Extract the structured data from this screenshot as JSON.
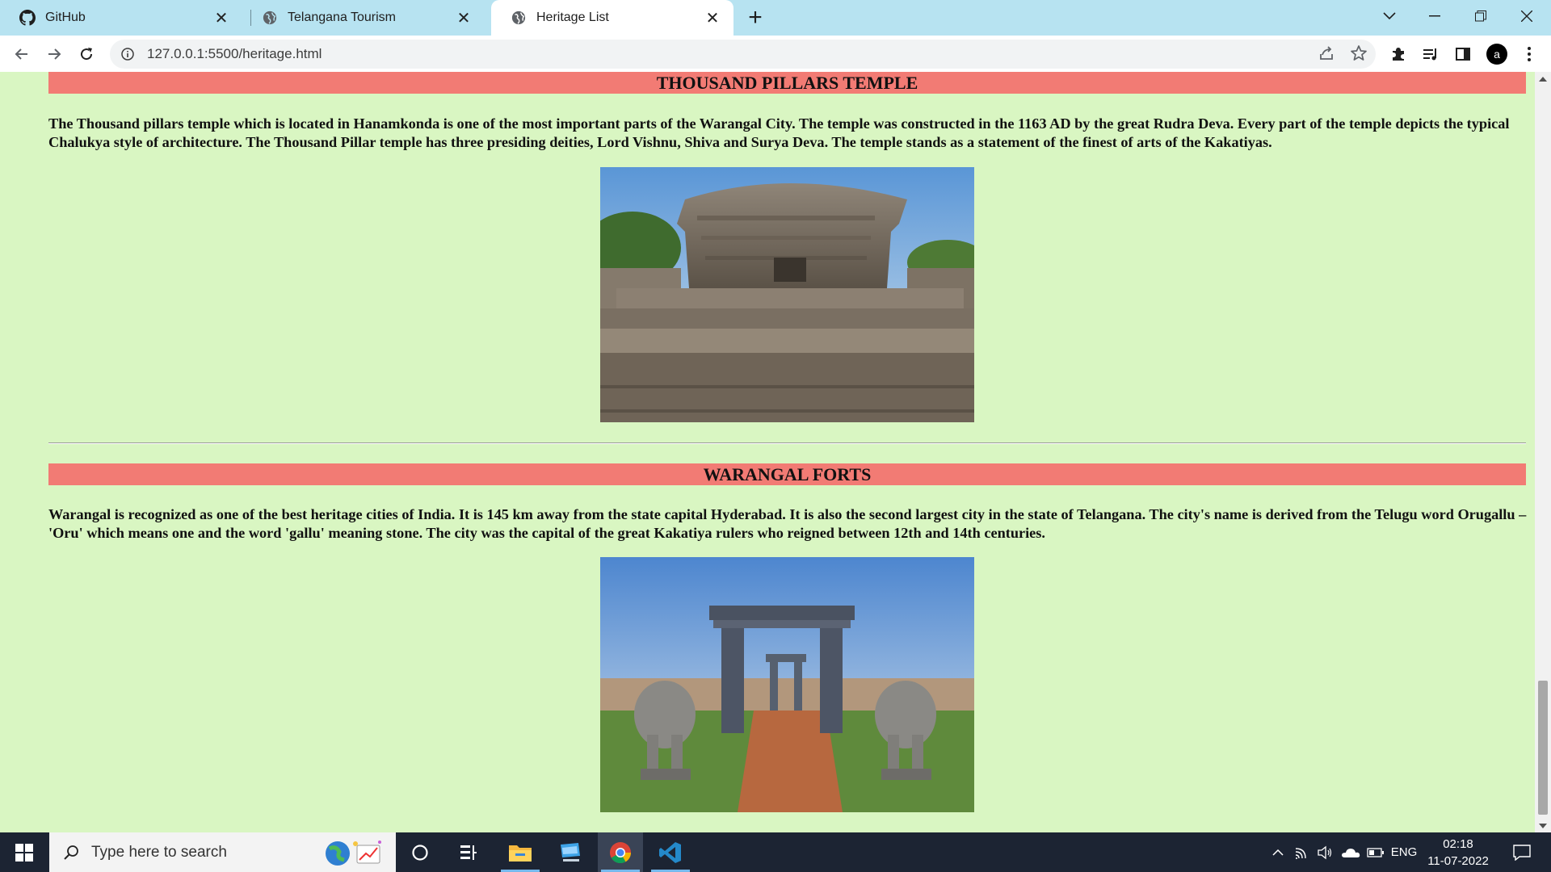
{
  "browser": {
    "tabs": [
      {
        "title": "GitHub",
        "icon": "github-icon"
      },
      {
        "title": "Telangana Tourism",
        "icon": "globe-icon"
      },
      {
        "title": "Heritage List",
        "icon": "globe-icon",
        "active": true
      }
    ],
    "url": "127.0.0.1:5500/heritage.html",
    "profile_initial": "a"
  },
  "page": {
    "sections": [
      {
        "heading": "THOUSAND PILLARS TEMPLE",
        "text": "The Thousand pillars temple which is located in Hanamkonda is one of the most important parts of the Warangal City. The temple was constructed in the 1163 AD by the great Rudra Deva. Every part of the temple depicts the typical Chalukya style of architecture. The Thousand Pillar temple has three presiding deities, Lord Vishnu, Shiva and Surya Deva. The temple stands as a statement of the finest of arts of the Kakatiyas.",
        "image": "thousand-pillars-temple-photo"
      },
      {
        "heading": "WARANGAL FORTS",
        "text": "Warangal is recognized as one of the best heritage cities of India. It is 145 km away from the state capital Hyderabad. It is also the second largest city in the state of Telangana. The city's name is derived from the Telugu word Orugallu – 'Oru' which means one and the word 'gallu' meaning stone. The city was the capital of the great Kakatiya rulers who reigned between 12th and 14th centuries.",
        "image": "warangal-fort-gateway-photo"
      }
    ],
    "colors": {
      "background": "#d9f6c2",
      "heading_band": "#f27b74"
    }
  },
  "taskbar": {
    "search_placeholder": "Type here to search",
    "language": "ENG",
    "time": "02:18",
    "date": "11-07-2022"
  }
}
